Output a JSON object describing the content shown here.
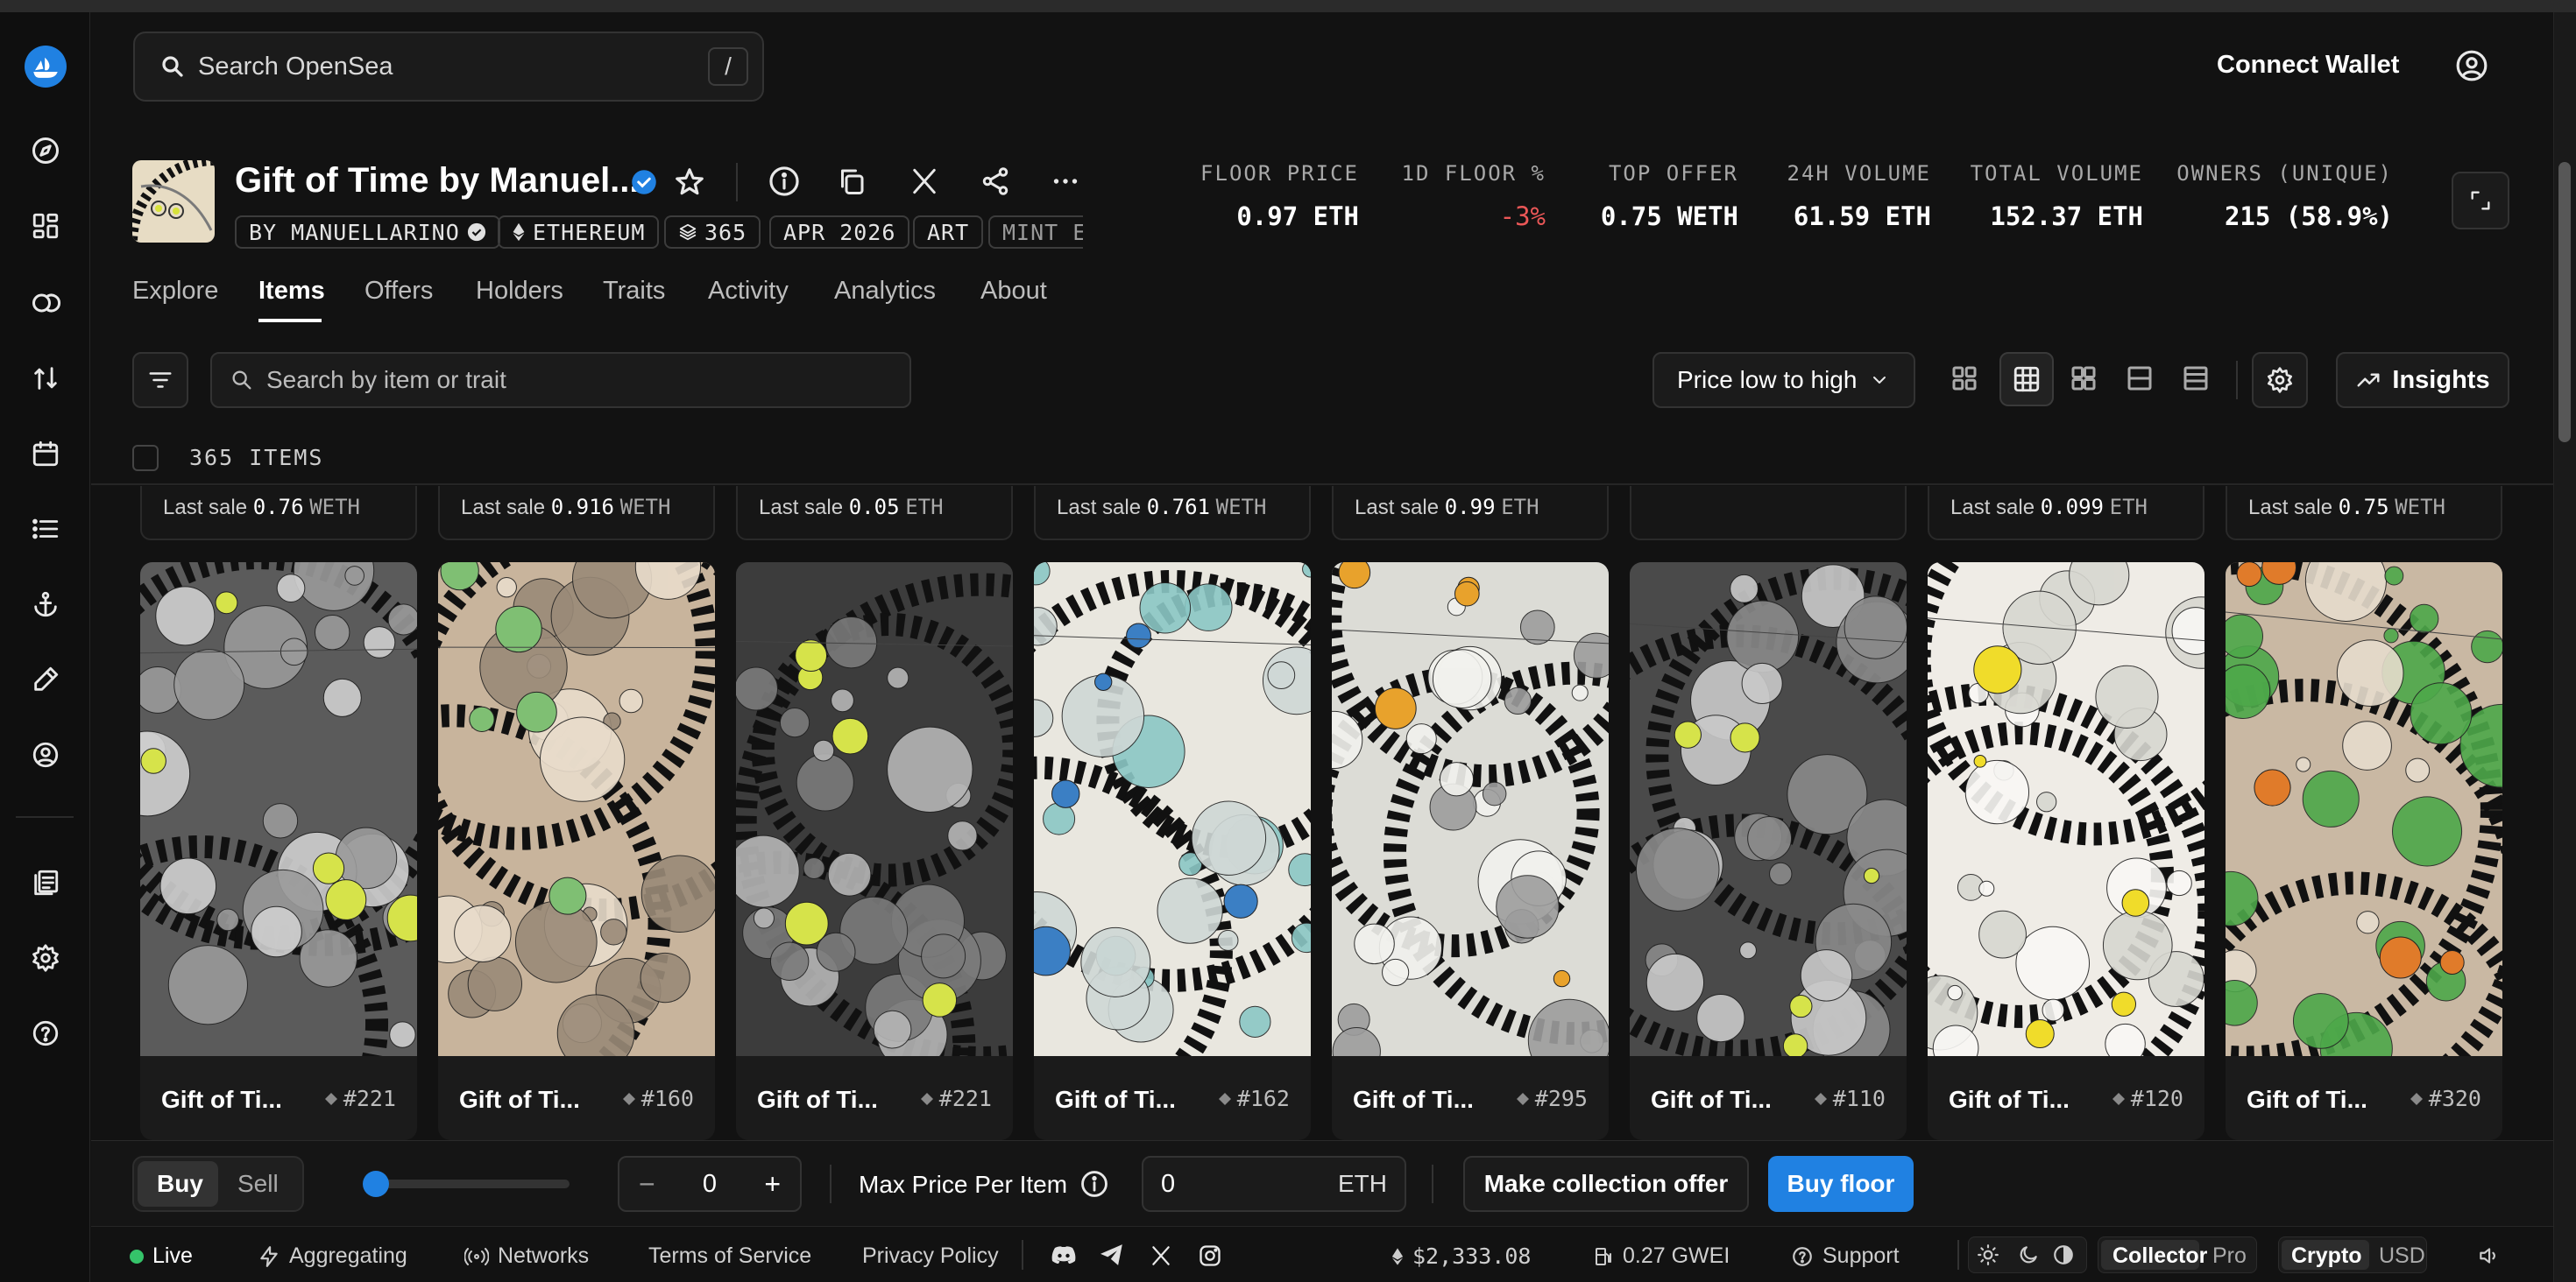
{
  "search": {
    "placeholder": "Search OpenSea",
    "shortcut": "/"
  },
  "header": {
    "connect_wallet": "Connect Wallet"
  },
  "collection": {
    "name": "Gift of Time by Manuel...",
    "chips": [
      "BY MANUELLARINO",
      "ETHEREUM",
      "365",
      "APR 2026",
      "ART",
      "MINT E"
    ]
  },
  "stats": [
    {
      "label": "FLOOR PRICE",
      "value": "0.97 ETH"
    },
    {
      "label": "1D FLOOR %",
      "value": "-3%"
    },
    {
      "label": "TOP OFFER",
      "value": "0.75 WETH"
    },
    {
      "label": "24H VOLUME",
      "value": "61.59 ETH"
    },
    {
      "label": "TOTAL VOLUME",
      "value": "152.37 ETH"
    },
    {
      "label": "OWNERS (UNIQUE)",
      "value": "215 (58.9%)"
    }
  ],
  "colors": {
    "accent": "#2081e2",
    "negative": "#eb5757"
  },
  "tabs": [
    "Explore",
    "Items",
    "Offers",
    "Holders",
    "Traits",
    "Activity",
    "Analytics",
    "About"
  ],
  "active_tab": "Items",
  "filter": {
    "placeholder": "Search by item or trait",
    "sort": "Price low to high",
    "insights": "Insights"
  },
  "items_count": "365 ITEMS",
  "last_sales": [
    {
      "label": "Last sale",
      "amount": "0.76",
      "currency": "WETH"
    },
    {
      "label": "Last sale",
      "amount": "0.916",
      "currency": "WETH"
    },
    {
      "label": "Last sale",
      "amount": "0.05",
      "currency": "ETH"
    },
    {
      "label": "Last sale",
      "amount": "0.761",
      "currency": "WETH"
    },
    {
      "label": "Last sale",
      "amount": "0.99",
      "currency": "ETH"
    },
    {
      "label": "",
      "amount": "",
      "currency": ""
    },
    {
      "label": "Last sale",
      "amount": "0.099",
      "currency": "ETH"
    },
    {
      "label": "Last sale",
      "amount": "0.75",
      "currency": "WETH"
    }
  ],
  "items": [
    {
      "name": "Gift of Ti...",
      "number": "#221"
    },
    {
      "name": "Gift of Ti...",
      "number": "#160"
    },
    {
      "name": "Gift of Ti...",
      "number": "#221"
    },
    {
      "name": "Gift of Ti...",
      "number": "#162"
    },
    {
      "name": "Gift of Ti...",
      "number": "#295"
    },
    {
      "name": "Gift of Ti...",
      "number": "#110"
    },
    {
      "name": "Gift of Ti...",
      "number": "#120"
    },
    {
      "name": "Gift of Ti...",
      "number": "#320"
    }
  ],
  "bottom": {
    "buy": "Buy",
    "sell": "Sell",
    "quantity": "0",
    "slider_fraction": 0,
    "max_price_label": "Max Price Per Item",
    "price_value": "0",
    "price_currency": "ETH",
    "collection_offer": "Make collection offer",
    "buy_floor": "Buy floor"
  },
  "footer": {
    "live": "Live",
    "aggregating": "Aggregating",
    "networks": "Networks",
    "terms": "Terms of Service",
    "privacy": "Privacy Policy",
    "eth_price": "$2,333.08",
    "gas": "0.27 GWEI",
    "support": "Support",
    "mode_collector": "Collector",
    "mode_pro": "Pro",
    "currency_crypto": "Crypto",
    "currency_usd": "USD"
  }
}
